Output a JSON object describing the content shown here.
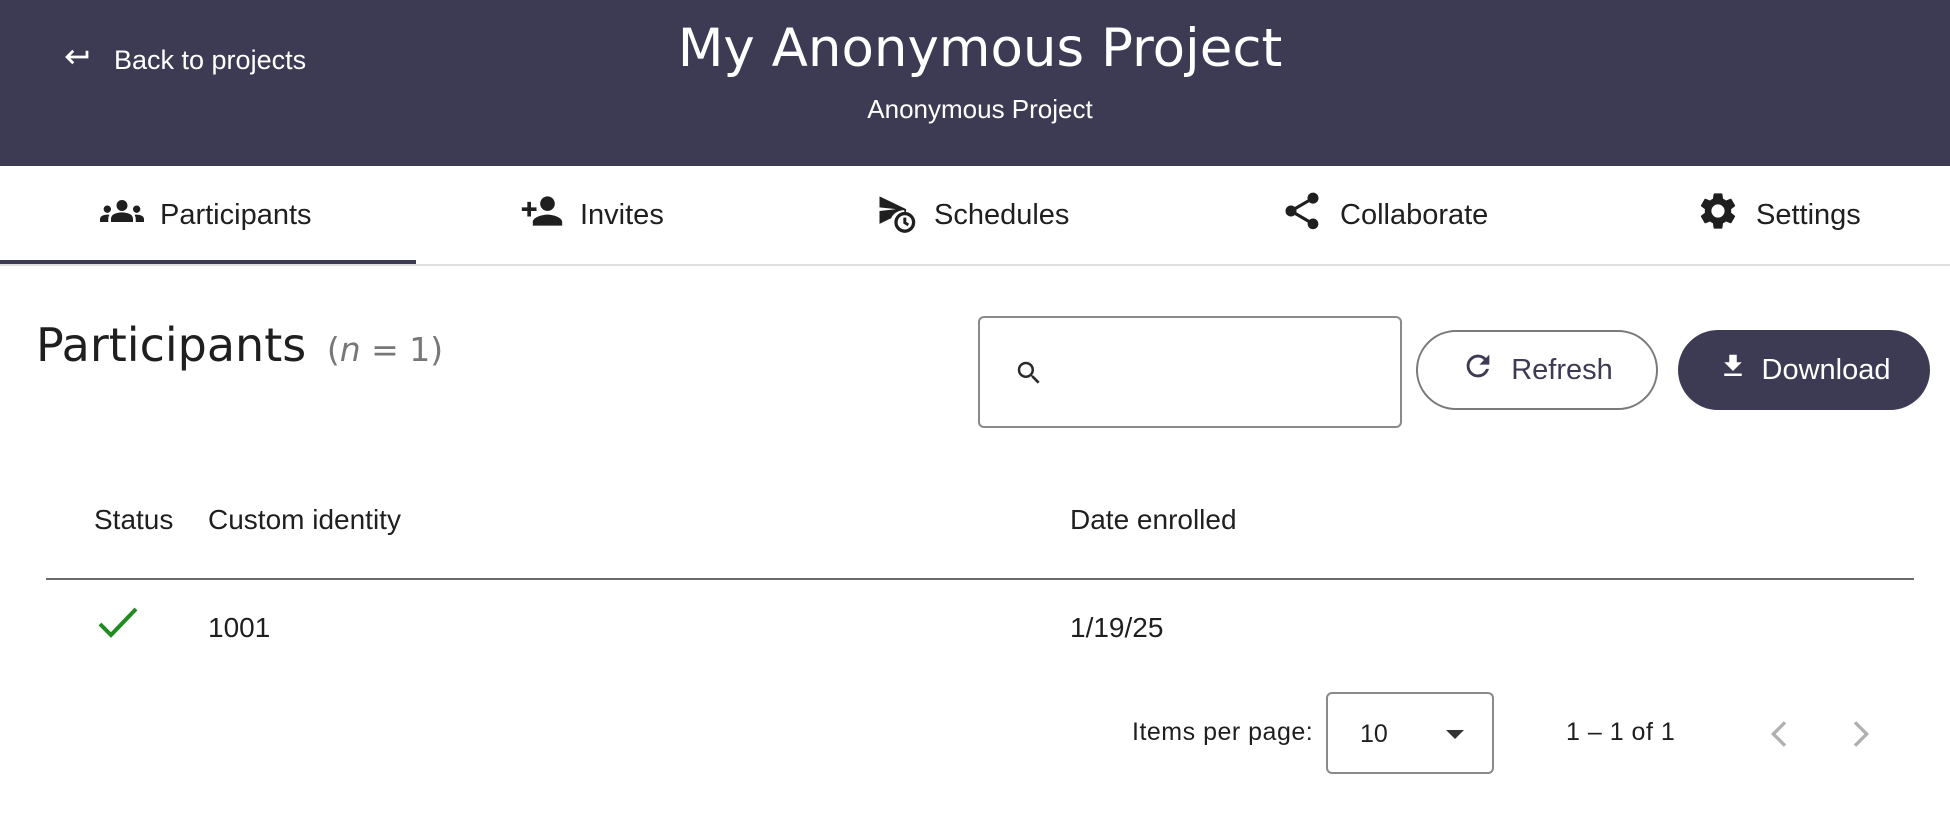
{
  "header": {
    "back_label": "Back to projects",
    "title": "My Anonymous Project",
    "subtitle": "Anonymous Project",
    "background": "#3d3a53"
  },
  "tabs": [
    {
      "label": "Participants",
      "icon": "group-icon",
      "active": true
    },
    {
      "label": "Invites",
      "icon": "person-add-icon",
      "active": false
    },
    {
      "label": "Schedules",
      "icon": "scheduled-send-icon",
      "active": false
    },
    {
      "label": "Collaborate",
      "icon": "share-icon",
      "active": false
    },
    {
      "label": "Settings",
      "icon": "gear-icon",
      "active": false
    }
  ],
  "main": {
    "heading": "Participants",
    "count_var": "n",
    "count_rest": " = 1)",
    "count_open": "(",
    "search": {
      "placeholder": "",
      "value": "",
      "icon": "search-icon"
    },
    "refresh_label": "Refresh",
    "download_label": "Download"
  },
  "table": {
    "columns": [
      "Status",
      "Custom identity",
      "Date enrolled"
    ],
    "rows": [
      {
        "status": "check-icon",
        "status_color": "#1e8c1e",
        "identity": "1001",
        "date": "1/19/25"
      }
    ]
  },
  "paginator": {
    "items_per_page_label": "Items per page:",
    "page_size": "10",
    "range": "1 – 1 of 1",
    "prev_icon": "chevron-left-icon",
    "next_icon": "chevron-right-icon"
  }
}
